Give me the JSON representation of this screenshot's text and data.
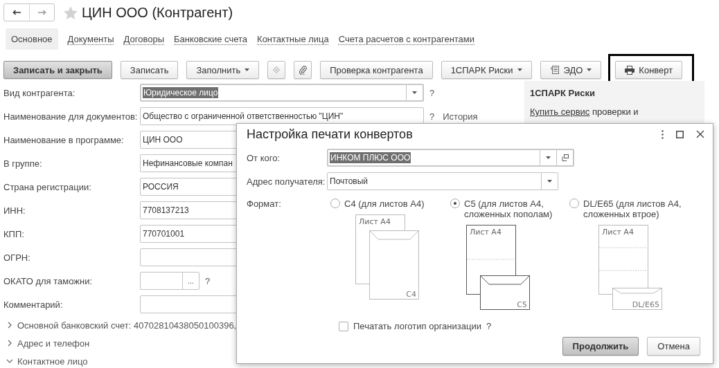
{
  "window": {
    "title": "ЦИН ООО (Контрагент)"
  },
  "tabs": [
    {
      "label": "Основное",
      "selected": true
    },
    {
      "label": "Документы",
      "selected": false
    },
    {
      "label": "Договоры",
      "selected": false
    },
    {
      "label": "Банковские счета",
      "selected": false
    },
    {
      "label": "Контактные лица",
      "selected": false
    },
    {
      "label": "Счета расчетов с контрагентами",
      "selected": false
    }
  ],
  "toolbar": [
    {
      "kind": "primary",
      "label": "Записать и закрыть",
      "highlighted": false
    },
    {
      "kind": "plain",
      "label": "Записать",
      "highlighted": false
    },
    {
      "kind": "menu",
      "label": "Заполнить",
      "highlighted": false
    },
    {
      "kind": "dots",
      "highlighted": false
    },
    {
      "kind": "clip",
      "highlighted": false
    },
    {
      "kind": "plain",
      "label": "Проверка контрагента",
      "highlighted": false
    },
    {
      "kind": "menu",
      "label": "1СПАРК Риски",
      "highlighted": false
    },
    {
      "kind": "edo",
      "label": "ЭДО",
      "highlighted": false
    },
    {
      "kind": "print",
      "label": "Конверт",
      "highlighted": true
    }
  ],
  "fields": [
    {
      "kind": "combo",
      "label": "Вид контрагента:",
      "value": "Юридическое лицо",
      "text_selected": true,
      "help": "?"
    },
    {
      "kind": "text",
      "label": "Наименование для документов:",
      "value": "Общество с ограниченной ответственностью \"ЦИН\"",
      "help": "?",
      "link": "История"
    },
    {
      "kind": "text",
      "label": "Наименование в программе:",
      "value": "ЦИН ООО"
    },
    {
      "kind": "text",
      "label": "В группе:",
      "value": "Нефинансовые компан"
    },
    {
      "kind": "text",
      "label": "Страна регистрации:",
      "value": "РОССИЯ"
    },
    {
      "kind": "text",
      "label": "ИНН:",
      "value": "7708137213"
    },
    {
      "kind": "text",
      "label": "КПП:",
      "value": "770701001"
    },
    {
      "kind": "text",
      "label": "ОГРН:"
    },
    {
      "kind": "pick",
      "label": "ОКАТО для таможни:",
      "button": "...",
      "help": "?"
    },
    {
      "kind": "text",
      "label": "Комментарий:"
    }
  ],
  "sections": [
    {
      "label": "Основной банковский счет: 40702810438050100396,",
      "expanded": false
    },
    {
      "label": "Адрес и телефон",
      "expanded": false
    },
    {
      "label": "Контактное лицо",
      "expanded": true
    }
  ],
  "side_panel": {
    "title": "1СПАРК Риски",
    "link": "Купить сервис",
    "text": "проверки и"
  },
  "dialog": {
    "title": "Настройка печати конвертов",
    "from": {
      "label": "От кого:",
      "value": "ИНКОМ ПЛЮС ООО",
      "text_selected": true
    },
    "address": {
      "label": "Адрес получателя:",
      "value": "Почтовый"
    },
    "format": {
      "label": "Формат:",
      "options": [
        {
          "kind": "c4",
          "label": "C4 (для листов А4)",
          "selected": false,
          "sheet_label": "Лист А4",
          "envelope_label": "C4"
        },
        {
          "kind": "c5",
          "label": "C5 (для листов А4, сложенных пополам)",
          "selected": true,
          "sheet_label": "Лист А4",
          "envelope_label": "C5"
        },
        {
          "kind": "dl",
          "label": "DL/E65 (для листов А4, сложенных втрое)",
          "selected": false,
          "sheet_label": "Лист А4",
          "envelope_label": "DL/E65"
        }
      ]
    },
    "logo": {
      "label": "Печатать логотип организации",
      "checked": false,
      "help": "?"
    },
    "buttons": [
      {
        "kind": "primary",
        "label": "Продолжить"
      },
      {
        "kind": "plain",
        "label": "Отмена"
      }
    ]
  }
}
